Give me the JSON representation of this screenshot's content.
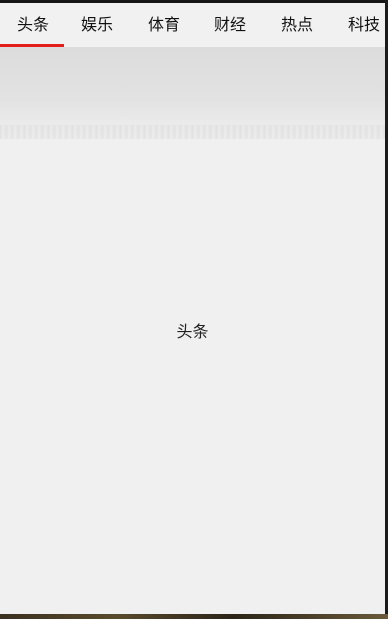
{
  "tabs": [
    {
      "label": "头条",
      "selected": true
    },
    {
      "label": "娱乐",
      "selected": false
    },
    {
      "label": "体育",
      "selected": false
    },
    {
      "label": "财经",
      "selected": false
    },
    {
      "label": "热点",
      "selected": false
    },
    {
      "label": "科技",
      "selected": false
    }
  ],
  "content": {
    "label": "头条"
  },
  "colors": {
    "indicator": "#e41d1d",
    "background": "#f0f0f0"
  }
}
